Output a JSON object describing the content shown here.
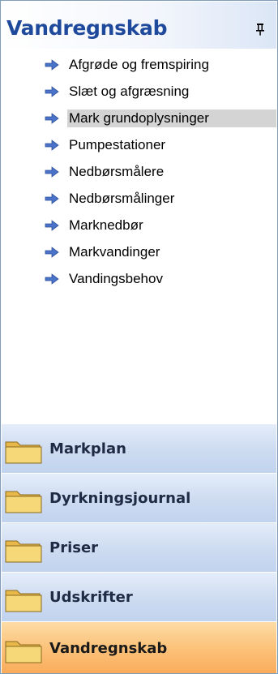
{
  "header": {
    "title": "Vandregnskab"
  },
  "items": [
    {
      "label": "Afgrøde og fremspiring",
      "selected": false
    },
    {
      "label": "Slæt og afgræsning",
      "selected": false
    },
    {
      "label": "Mark grundoplysninger",
      "selected": true
    },
    {
      "label": "Pumpestationer",
      "selected": false
    },
    {
      "label": "Nedbørsmålere",
      "selected": false
    },
    {
      "label": "Nedbørsmålinger",
      "selected": false
    },
    {
      "label": "Marknedbør",
      "selected": false
    },
    {
      "label": "Markvandinger",
      "selected": false
    },
    {
      "label": "Vandingsbehov",
      "selected": false
    }
  ],
  "categories": [
    {
      "label": "Markplan",
      "active": false
    },
    {
      "label": "Dyrkningsjournal",
      "active": false
    },
    {
      "label": "Priser",
      "active": false
    },
    {
      "label": "Udskrifter",
      "active": false
    },
    {
      "label": "Vandregnskab",
      "active": true
    }
  ],
  "colors": {
    "header_text": "#1f4a9c",
    "arrow": "#4a73c9",
    "selected_bg": "#d4d4d4",
    "category_bg": "#c9d9f0",
    "active_category_bg": "#fbbd6f"
  },
  "icons": {
    "pin": "pin-icon",
    "item": "arrow-right-icon",
    "category": "folder-icon"
  }
}
